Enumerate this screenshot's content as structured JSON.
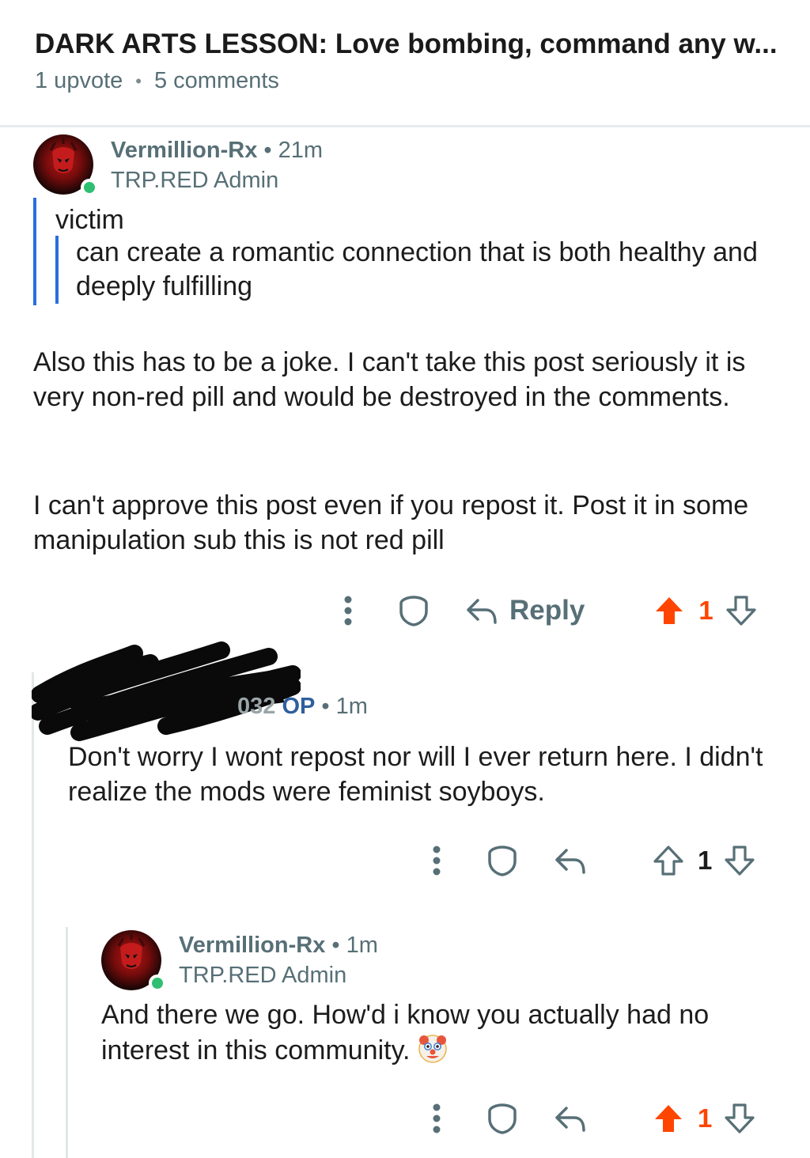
{
  "post": {
    "title": "DARK ARTS LESSON: Love bombing, command any w...",
    "upvotes": "1 upvote",
    "separator": "•",
    "comments": "5 comments"
  },
  "comments": [
    {
      "username": "Vermillion-Rx",
      "time": "• 21m",
      "flair": "TRP.RED Admin",
      "quote_word": "victim",
      "quote_text": "can create a romantic connection that is both healthy and deeply fulfilling",
      "paragraph1": "Also this has to be a joke. I can't take this post seriously it is very non-red pill and would be destroyed in the comments.",
      "paragraph2": "I can't approve this post even if you repost it. Post it in some manipulation sub this is not red pill",
      "reply_label": "Reply",
      "votes": "1",
      "upvoted": true
    },
    {
      "username_fragment": "032",
      "op_label": "OP",
      "time": "• 1m",
      "text": "Don't worry I wont repost nor will I ever return here. I didn't realize the mods were feminist soyboys.",
      "votes": "1",
      "upvoted": false
    },
    {
      "username": "Vermillion-Rx",
      "time": "• 1m",
      "flair": "TRP.RED Admin",
      "text": "And there we go. How'd i know you actually had no interest in this community.",
      "emoji": "clown-face",
      "votes": "1",
      "upvoted": true
    }
  ],
  "icons": {
    "more": "more-vertical-icon",
    "award": "award-shield-icon",
    "reply": "reply-arrow-icon",
    "upvote": "upvote-arrow-icon",
    "downvote": "downvote-arrow-icon"
  },
  "colors": {
    "upvote_active": "#ff4500",
    "online": "#2fbf71",
    "quote_bar": "#2a6fdb",
    "op_tag": "#2e5f9e",
    "meta_text": "#576f76"
  }
}
